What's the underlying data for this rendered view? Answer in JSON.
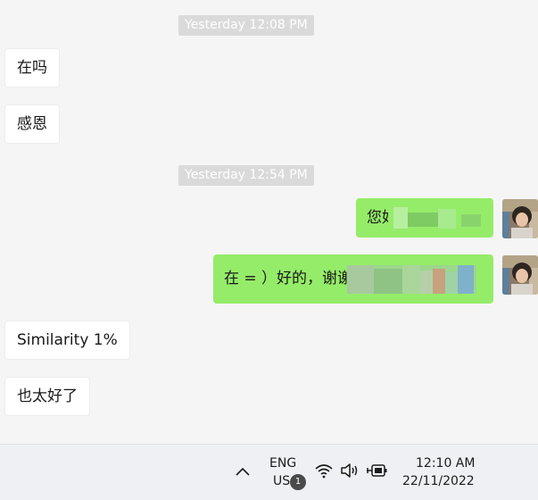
{
  "chat": {
    "timestamps": [
      "Yesterday 12:08 PM",
      "Yesterday 12:54 PM"
    ],
    "messages": [
      {
        "side": "in",
        "text": "在吗"
      },
      {
        "side": "in",
        "text": "感恩"
      },
      {
        "side": "out",
        "text": "您好"
      },
      {
        "side": "out",
        "text": "在 = ）好的，谢谢"
      },
      {
        "side": "in",
        "text": "Similarity 1%"
      },
      {
        "side": "in",
        "text": "也太好了"
      }
    ]
  },
  "taskbar": {
    "language_top": "ENG",
    "language_bottom": "US",
    "notification_count": "1",
    "time": "12:10 AM",
    "date": "22/11/2022",
    "icons": [
      "chevron-up-icon",
      "wifi-icon",
      "speaker-icon",
      "battery-charging-icon"
    ]
  },
  "colors": {
    "chat_background": "#f5f5f5",
    "outgoing_bubble": "#95ec69",
    "incoming_bubble": "#ffffff",
    "timestamp_background": "#dadada",
    "taskbar_background": "#eef0f3"
  }
}
